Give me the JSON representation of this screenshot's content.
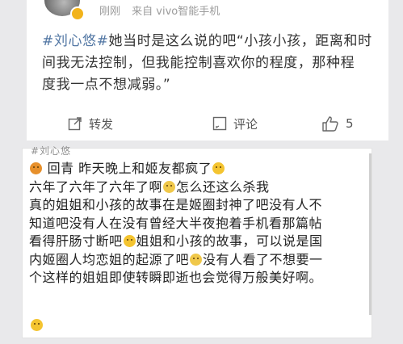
{
  "post": {
    "meta_time": "刚刚",
    "meta_source": "来自 vivo智能手机",
    "hashtag": "#刘心悠#",
    "text_line1_rest": "她当时是这么说的吧“小孩小孩，距离和时",
    "text_line2": "间我无法控制，但我能控制喜欢你的程度，那种程",
    "text_line3": "度我一点不想减弱。”",
    "repost_label": "转发",
    "comment_label": "评论",
    "like_count": "5"
  },
  "second_card": {
    "top_label": "#刘心悠",
    "line1_text": "回青 昨天晚上和姬友都疯了",
    "line2_a": "六年了六年了六年了啊",
    "line2_b": "怎么还这么杀我",
    "line3": "真的姐姐和小孩的故事在是姬圈封神了吧没有人不",
    "line4": "知道吧没有人在没有曾经大半夜抱着手机看那篇帖",
    "line5_a": "看得肝肠寸断吧",
    "line5_b": "姐姐和小孩的故事，可以说是国",
    "line6_a": "内姬圈人均恋姐的起源了吧",
    "line6_b": "没有人看了不想要一",
    "line7": "个这样的姐姐即使转瞬即逝也会觉得万般美好啊。"
  },
  "colors": {
    "hashtag": "#5176a3",
    "text": "#333333",
    "background": "#e9e9eb"
  },
  "icons": [
    "avatar",
    "vip-badge-icon",
    "repost-icon",
    "comment-icon",
    "like-icon",
    "emoji-icon"
  ]
}
